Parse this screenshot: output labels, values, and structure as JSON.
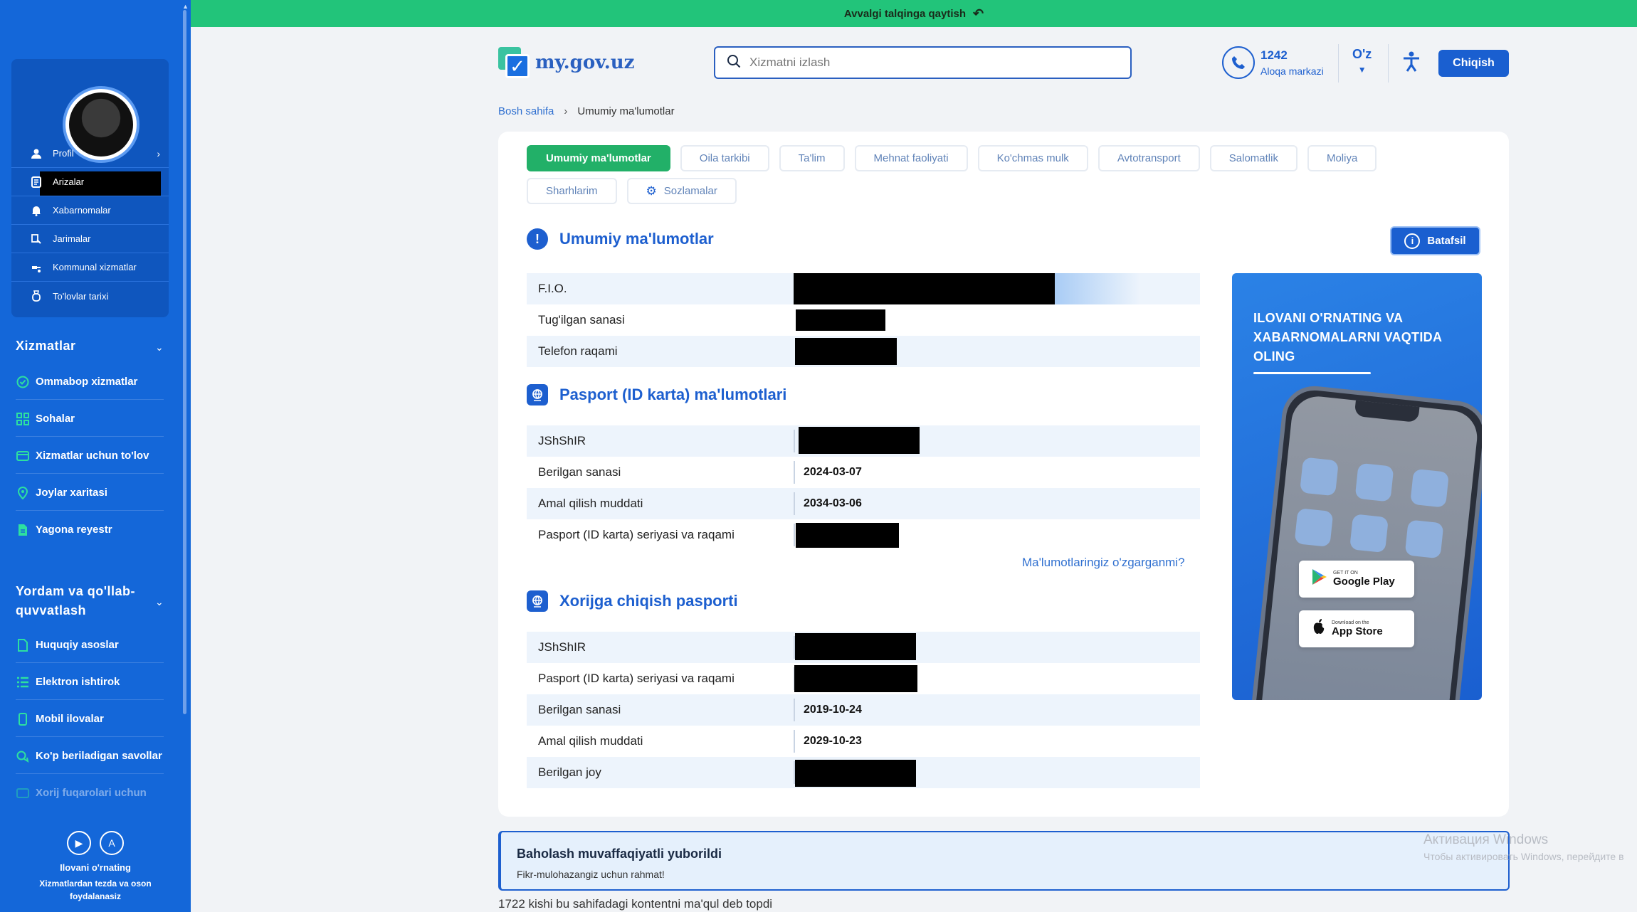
{
  "banner": {
    "text": "Avvalgi talqinga qaytish"
  },
  "header": {
    "logo": "my.gov.uz",
    "search_placeholder": "Xizmatni izlash",
    "phone_number": "1242",
    "phone_label": "Aloqa markazi",
    "language": "O'z",
    "logout": "Chiqish"
  },
  "breadcrumb": {
    "home": "Bosh sahifa",
    "current": "Umumiy ma'lumotlar"
  },
  "sidebar": {
    "menu": [
      {
        "label": "Profil",
        "icon": "user-icon"
      },
      {
        "label": "Arizalar",
        "icon": "document-icon"
      },
      {
        "label": "Xabarnomalar",
        "icon": "bell-icon"
      },
      {
        "label": "Jarimalar",
        "icon": "fine-icon"
      },
      {
        "label": "Kommunal xizmatlar",
        "icon": "utility-icon"
      },
      {
        "label": "To'lovlar tarixi",
        "icon": "wallet-icon"
      }
    ],
    "services_title": "Xizmatlar",
    "services": [
      {
        "label": "Ommabop xizmatlar",
        "icon": "check-badge-icon"
      },
      {
        "label": "Sohalar",
        "icon": "grid-icon"
      },
      {
        "label": "Xizmatlar uchun to'lov",
        "icon": "card-icon"
      },
      {
        "label": "Joylar xaritasi",
        "icon": "map-pin-icon"
      },
      {
        "label": "Yagona reyestr",
        "icon": "file-icon"
      }
    ],
    "support_title": "Yordam va qo'llab-quvvatlash",
    "support": [
      {
        "label": "Huquqiy asoslar",
        "icon": "doc-icon"
      },
      {
        "label": "Elektron ishtirok",
        "icon": "list-icon"
      },
      {
        "label": "Mobil ilovalar",
        "icon": "mobile-icon"
      },
      {
        "label": "Ko'p beriladigan savollar",
        "icon": "chat-icon"
      },
      {
        "label": "Xorij fuqarolari uchun",
        "icon": "globe-icon"
      }
    ],
    "footer_title": "Ilovani o'rnating",
    "footer_sub": "Xizmatlardan tezda va oson foydalanasiz"
  },
  "tabs": [
    "Umumiy ma'lumotlar",
    "Oila tarkibi",
    "Ta'lim",
    "Mehnat faoliyati",
    "Ko'chmas mulk",
    "Avtotransport",
    "Salomatlik",
    "Moliya",
    "Sharhlarim",
    "Sozlamalar"
  ],
  "general": {
    "title": "Umumiy ma'lumotlar",
    "details_button": "Batafsil",
    "rows": [
      {
        "label": "F.I.O."
      },
      {
        "label": "Tug'ilgan sanasi"
      },
      {
        "label": "Telefon raqami"
      }
    ]
  },
  "passport": {
    "title": "Pasport (ID karta) ma'lumotlari",
    "rows": [
      {
        "label": "JShShIR",
        "value": ""
      },
      {
        "label": "Berilgan sanasi",
        "value": "2024-03-07"
      },
      {
        "label": "Amal qilish muddati",
        "value": "2034-03-06"
      },
      {
        "label": "Pasport (ID karta) seriyasi va raqami",
        "value": ""
      }
    ],
    "changed_link": "Ma'lumotlaringiz o'zgarganmi?"
  },
  "foreign": {
    "title": "Xorijga chiqish pasporti",
    "rows": [
      {
        "label": "JShShIR",
        "value": ""
      },
      {
        "label": "Pasport (ID karta) seriyasi va raqami",
        "value": ""
      },
      {
        "label": "Berilgan sanasi",
        "value": "2019-10-24"
      },
      {
        "label": "Amal qilish muddati",
        "value": "2029-10-23"
      },
      {
        "label": "Berilgan joy",
        "value": ""
      }
    ]
  },
  "promo": {
    "title": "ILOVANI O'RNATING VA XABARNOMALARNI VAQTIDA OLING",
    "google_small": "GET IT ON",
    "google_big": "Google Play",
    "apple_small": "Download on the",
    "apple_big": "App Store"
  },
  "feedback": {
    "title": "Baholash muvaffaqiyatli yuborildi",
    "subtitle": "Fikr-mulohazangiz uchun rahmat!",
    "likes": "1722 kishi bu sahifadagi kontentni ma'qul deb topdi"
  },
  "watermark": {
    "title": "Активация Windows",
    "subtitle": "Чтобы активировать Windows, перейдите в"
  }
}
